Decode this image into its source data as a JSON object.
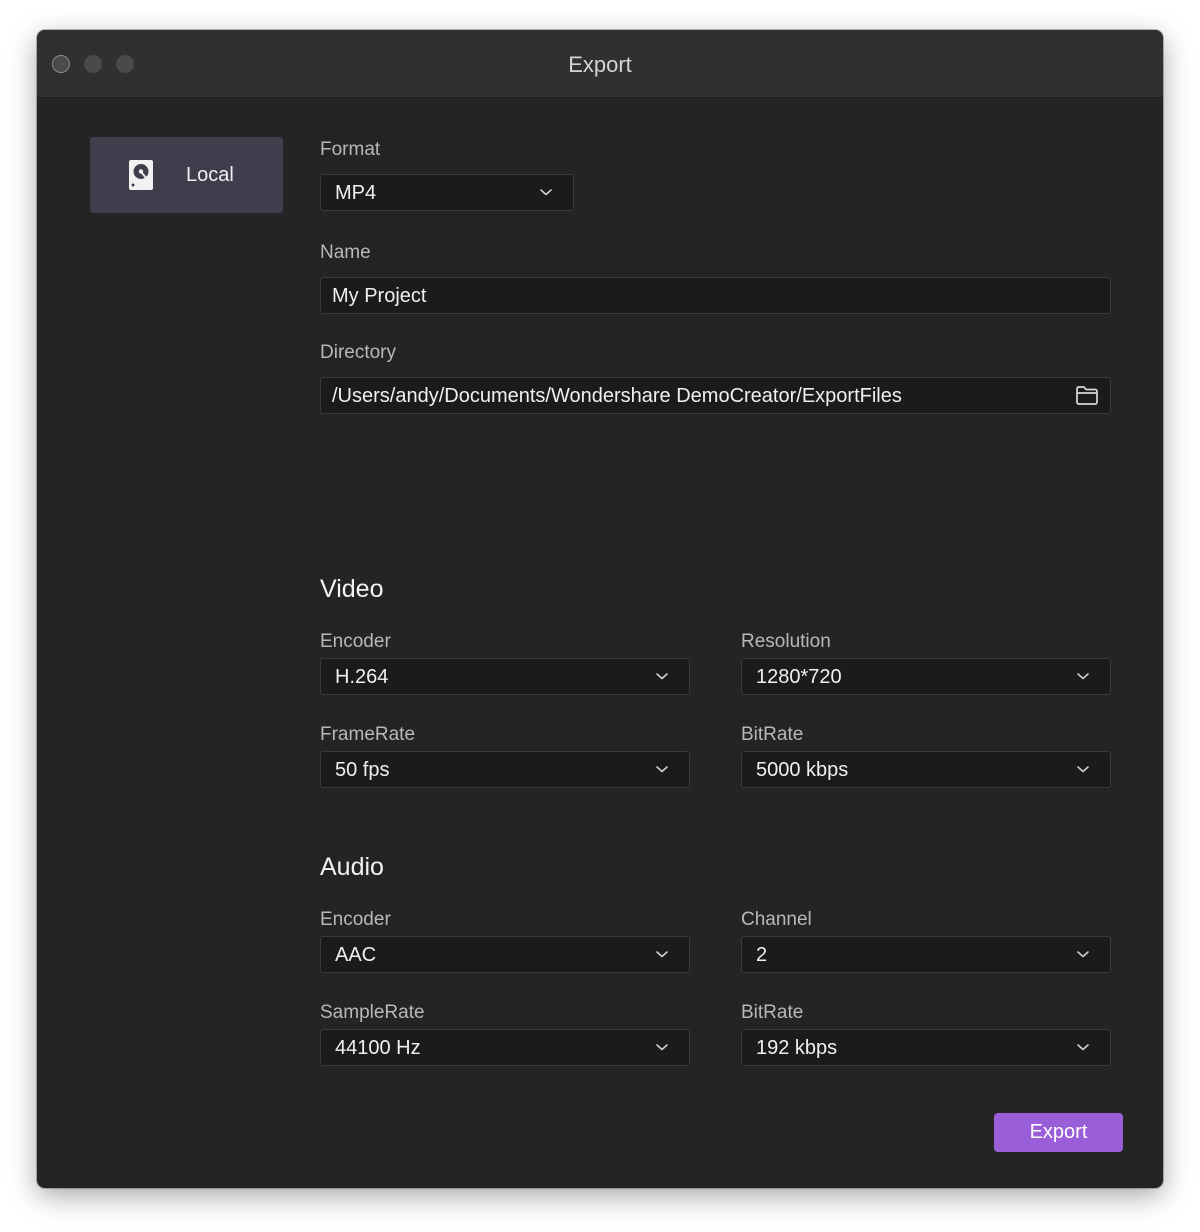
{
  "window": {
    "title": "Export"
  },
  "sidebar": {
    "items": [
      {
        "label": "Local",
        "icon": "hard-drive-icon",
        "selected": true
      }
    ]
  },
  "general": {
    "format": {
      "label": "Format",
      "value": "MP4"
    },
    "name": {
      "label": "Name",
      "value": "My Project"
    },
    "directory": {
      "label": "Directory",
      "value": "/Users/andy/Documents/Wondershare DemoCreator/ExportFiles",
      "icon": "folder-icon"
    }
  },
  "video": {
    "heading": "Video",
    "encoder": {
      "label": "Encoder",
      "value": "H.264"
    },
    "resolution": {
      "label": "Resolution",
      "value": "1280*720"
    },
    "framerate": {
      "label": "FrameRate",
      "value": "50 fps"
    },
    "bitrate": {
      "label": "BitRate",
      "value": "5000 kbps"
    }
  },
  "audio": {
    "heading": "Audio",
    "encoder": {
      "label": "Encoder",
      "value": "AAC"
    },
    "channel": {
      "label": "Channel",
      "value": "2"
    },
    "samplerate": {
      "label": "SampleRate",
      "value": "44100 Hz"
    },
    "bitrate": {
      "label": "BitRate",
      "value": "192 kbps"
    }
  },
  "actions": {
    "export_label": "Export"
  },
  "colors": {
    "accent": "#9a5fd8",
    "window_bg": "#242424",
    "titlebar_bg": "#303030",
    "sidebar_selected_bg": "#403d4d",
    "field_bg": "#1b1b1b"
  }
}
